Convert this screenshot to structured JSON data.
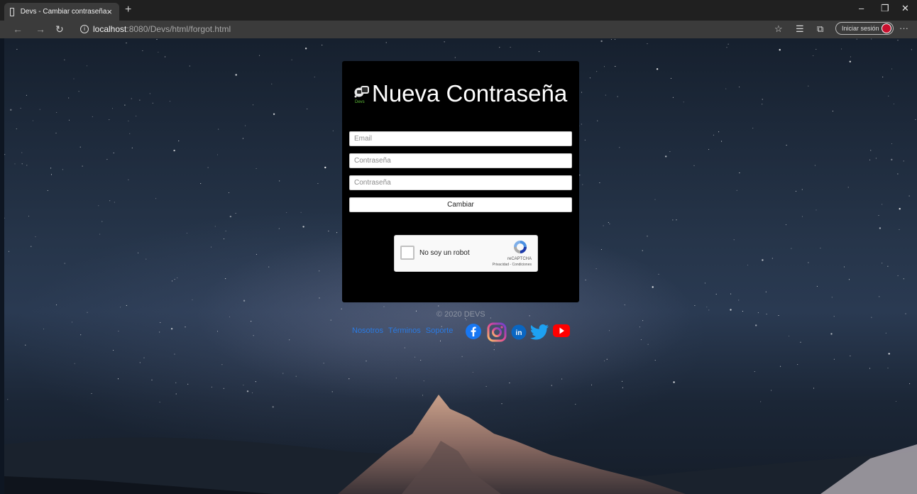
{
  "browser": {
    "tab_title": "Devs - Cambiar contraseña",
    "tab_close": "×",
    "new_tab": "+",
    "url_host": "localhost",
    "url_path": ":8080/Devs/html/forgot.html",
    "signin_label": "Iniciar sesión",
    "window_controls": {
      "minimize": "–",
      "restore": "❐",
      "close": "✕"
    },
    "nav": {
      "back": "←",
      "forward": "→",
      "refresh": "↻"
    },
    "toolbar_icons": [
      "star-icon",
      "favorites-icon",
      "collections-icon",
      "more-icon"
    ]
  },
  "form": {
    "logo_text": "Devs",
    "title": "Nueva Contraseña",
    "email_placeholder": "Email",
    "password_placeholder": "Contraseña",
    "confirm_placeholder": "Contraseña",
    "submit_label": "Cambiar"
  },
  "captcha": {
    "label": "No soy un robot",
    "brand": "reCAPTCHA",
    "links": "Privacidad - Condiciones"
  },
  "footer": {
    "copyright": "© 2020 DEVS",
    "links": [
      "Nosotros",
      "Términos",
      "Soporte"
    ],
    "social_icons": [
      "facebook-icon",
      "instagram-icon",
      "linkedin-icon",
      "twitter-icon",
      "youtube-icon"
    ]
  },
  "colors": {
    "card_bg": "#000000",
    "link": "#2a7ae2",
    "facebook": "#1877f2",
    "linkedin": "#0a66c2",
    "twitter": "#1da1f2",
    "youtube": "#ff0000",
    "signin_avatar": "#c8102e"
  }
}
